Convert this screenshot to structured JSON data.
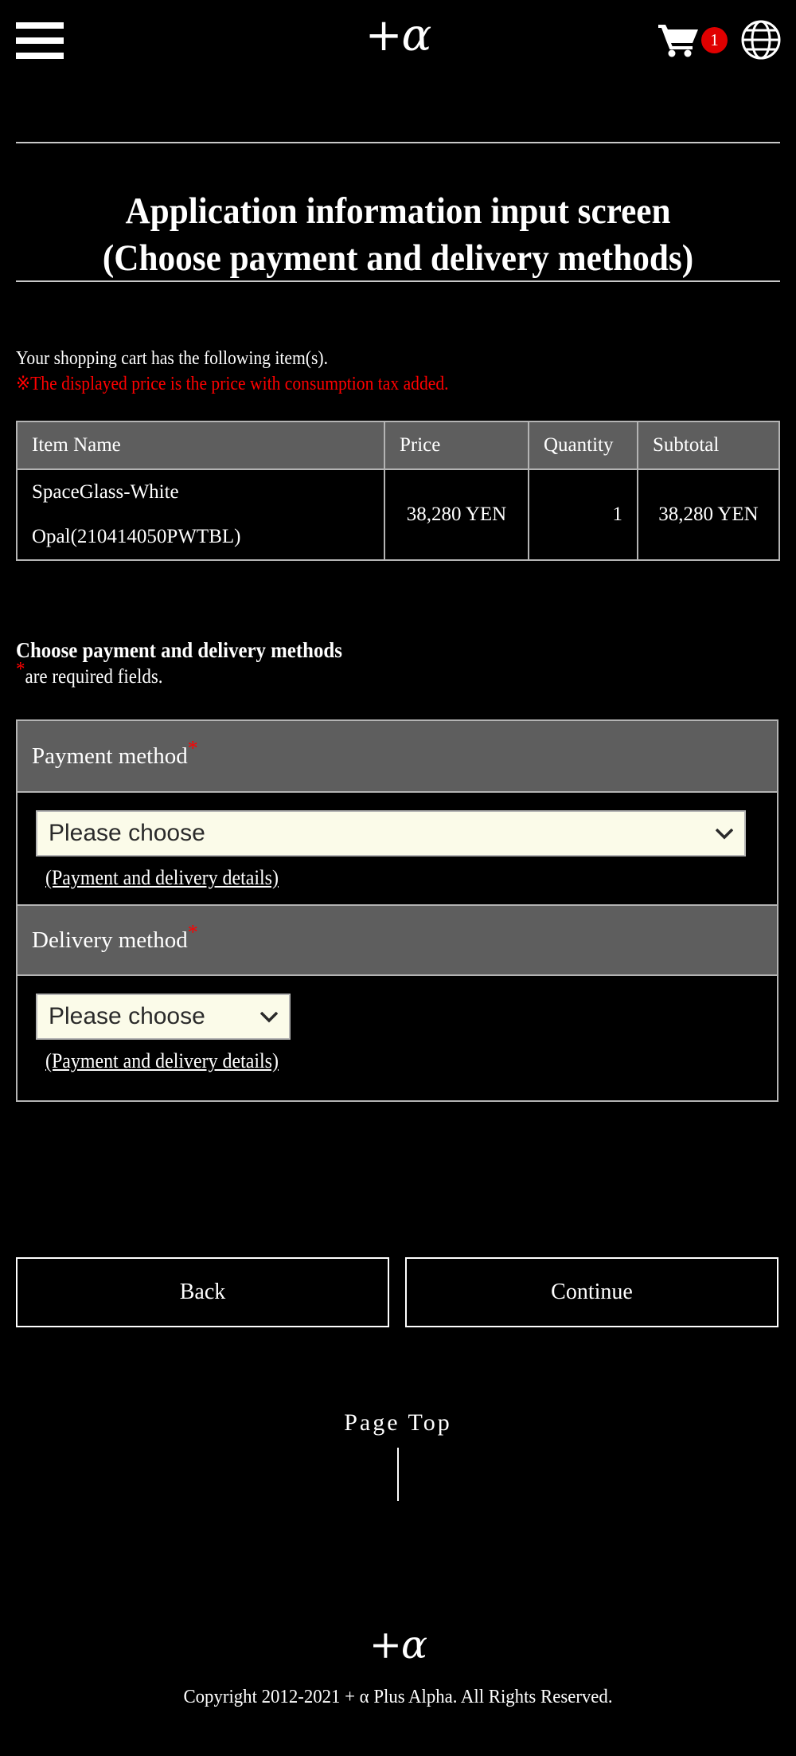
{
  "header": {
    "menu_label": "Menu",
    "logo_plus": "+",
    "logo_alpha": "α",
    "cart_icon": "shopping-cart-icon",
    "cart_count": "1",
    "language_icon": "globe-icon"
  },
  "title": {
    "line1": "Application information input screen",
    "line2": "(Choose payment and delivery methods)",
    "full": "Application information input screen\n(Choose payment and delivery methods)"
  },
  "cart": {
    "note": "Your shopping cart has the following item(s).",
    "tax_note": "※The displayed price is the price with consumption tax added.",
    "columns": [
      "Item Name",
      "Price",
      "Quantity",
      "Subtotal"
    ],
    "rows": [
      {
        "item_line1": "SpaceGlass-White",
        "item_line2": "Opal(210414050PWTBL)",
        "price": "38,280 YEN",
        "quantity": "1",
        "subtotal": "38,280 YEN"
      }
    ]
  },
  "form": {
    "heading": "Choose payment and delivery methods",
    "required_star": "*",
    "required_note": "are required fields.",
    "payment": {
      "label": "Payment method",
      "star": "*",
      "selected": "Please choose",
      "options": [
        "Please choose"
      ],
      "details_link": "(Payment and delivery details)",
      "chevron": "⌄"
    },
    "delivery": {
      "label": "Delivery method",
      "star": "*",
      "selected": "Please choose",
      "options": [
        "Please choose"
      ],
      "details_link": "(Payment and delivery details)",
      "chevron": "⌄"
    }
  },
  "actions": {
    "back_label": "Back",
    "continue_label": "Continue"
  },
  "page_top": {
    "label": "Page Top"
  },
  "footer": {
    "logo_plus": "+",
    "logo_alpha": "α",
    "copyright": "Copyright 2012-2021 + α Plus Alpha. All Rights Reserved."
  },
  "colors": {
    "background": "#000000",
    "text": "#ffffff",
    "accent_red": "#ff0000",
    "badge_red": "#e00000",
    "header_gray": "#5e5e5e",
    "border_gray": "#b4b4b4",
    "select_bg": "#fbfbe9"
  }
}
